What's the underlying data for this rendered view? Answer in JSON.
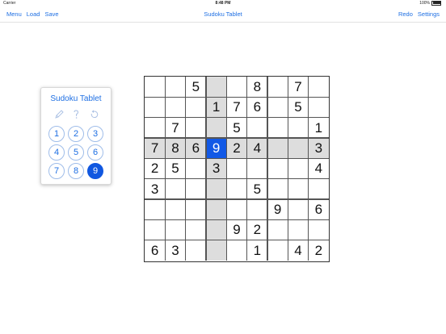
{
  "status": {
    "carrier": "Carrier",
    "time": "8:48 PM",
    "battery": "100%"
  },
  "nav": {
    "menu": "Menu",
    "load": "Load",
    "save": "Save",
    "title": "Sudoku Tablet",
    "redo": "Redo",
    "settings": "Settings"
  },
  "panel": {
    "title": "Sudoku Tablet",
    "tools": [
      "pencil-icon",
      "hint-icon",
      "undo-icon"
    ],
    "numbers": [
      "1",
      "2",
      "3",
      "4",
      "5",
      "6",
      "7",
      "8",
      "9"
    ],
    "selected_number": "9"
  },
  "board": {
    "grid": [
      [
        "",
        "",
        "5",
        "",
        "",
        "8",
        "",
        "7",
        ""
      ],
      [
        "",
        "",
        "",
        "1",
        "7",
        "6",
        "",
        "5",
        ""
      ],
      [
        "",
        "7",
        "",
        "",
        "5",
        "",
        "",
        "",
        "1"
      ],
      [
        "7",
        "8",
        "6",
        "9",
        "2",
        "4",
        "",
        "",
        "3"
      ],
      [
        "2",
        "5",
        "",
        "3",
        "",
        "",
        "",
        "",
        "4"
      ],
      [
        "3",
        "",
        "",
        "",
        "",
        "5",
        "",
        "",
        ""
      ],
      [
        "",
        "",
        "",
        "",
        "",
        "",
        "9",
        "",
        "6"
      ],
      [
        "",
        "",
        "",
        "",
        "9",
        "2",
        "",
        "",
        ""
      ],
      [
        "6",
        "3",
        "",
        "",
        "",
        "1",
        "",
        "4",
        "2"
      ]
    ],
    "selected_row": 3,
    "selected_col": 3,
    "colors": {
      "selected": "#1259e6",
      "highlight": "#dddddd",
      "accent": "#1e6fe3"
    }
  }
}
